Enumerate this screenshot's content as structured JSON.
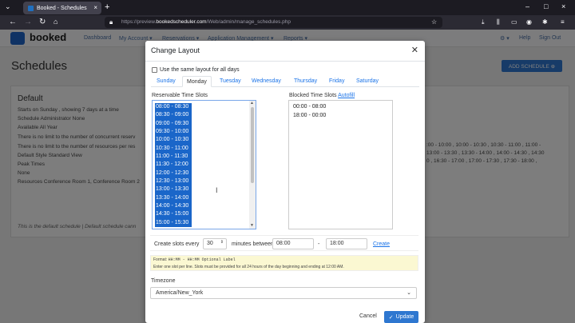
{
  "browser": {
    "tab_title": "Booked - Schedules",
    "url_prefix": "https://preview.",
    "url_domain": "bookedscheduler.com",
    "url_path": "/Web/admin/manage_schedules.php"
  },
  "app": {
    "logo_text": "booked",
    "nav": [
      "Dashboard",
      "My Account ▾",
      "Reservations ▾",
      "Application Management ▾",
      "Reports ▾"
    ],
    "help": "Help",
    "signout": "Sign Out",
    "page_title": "Schedules",
    "add_button": "ADD SCHEDULE ⊕"
  },
  "schedule_card": {
    "title": "Default",
    "lines": [
      "Starts on Sunday , showing 7 days at a time",
      "Schedule Administrator None",
      "Available All Year",
      "There is no limit to the number of concurrent reserv",
      "There is no limit to the number of resources per res",
      "Default Style Standard View",
      "Peak Times",
      "None",
      "Resources Conference Room 1, Conference Room 2"
    ],
    "right_lines": [
      ":00 - 10:00 , 10:00 - 10:30 , 10:30 - 11:00 , 11:00 -",
      "13:00 - 13:30 , 13:30 - 14:00 , 14:00 - 14:30 , 14:30",
      "0 , 16:30 - 17:00 , 17:00 - 17:30 , 17:30 - 18:00 ,"
    ],
    "note": "This is the default schedule | Default schedule cann"
  },
  "modal": {
    "title": "Change Layout",
    "same_layout_label": "Use the same layout for all days",
    "days": [
      "Sunday",
      "Monday",
      "Tuesday",
      "Wednesday",
      "Thursday",
      "Friday",
      "Saturday"
    ],
    "active_day": "Monday",
    "reservable_label": "Reservable Time Slots",
    "blocked_label": "Blocked Time Slots",
    "autofill": "Autofill",
    "reservable_slots": [
      "08:00 - 08:30",
      "08:30 - 09:00",
      "09:00 - 09:30",
      "09:30 - 10:00",
      "10:00 - 10:30",
      "10:30 - 11:00",
      "11:00 - 11:30",
      "11:30 - 12:00",
      "12:00 - 12:30",
      "12:30 - 13:00",
      "13:00 - 13:30",
      "13:30 - 14:00",
      "14:00 - 14:30",
      "14:30 - 15:00",
      "15:00 - 15:30"
    ],
    "blocked_slots": [
      "00:00 - 08:00",
      "18:00 - 00:00"
    ],
    "create_every": "Create slots every",
    "interval_value": "30",
    "minutes_between": "minutes between",
    "start_time": "08:00",
    "dash": "-",
    "end_time": "18:00",
    "create_link": "Create",
    "format_label": "Format:",
    "format_code": "HH:MM - HH:MM Optional Label",
    "format_help": "Enter one slot per line. Slots must be provided for all 24 hours of the day beginning and ending at 12:00 AM.",
    "timezone_label": "Timezone",
    "timezone_value": "America/New_York",
    "cancel": "Cancel",
    "update": "Update"
  }
}
